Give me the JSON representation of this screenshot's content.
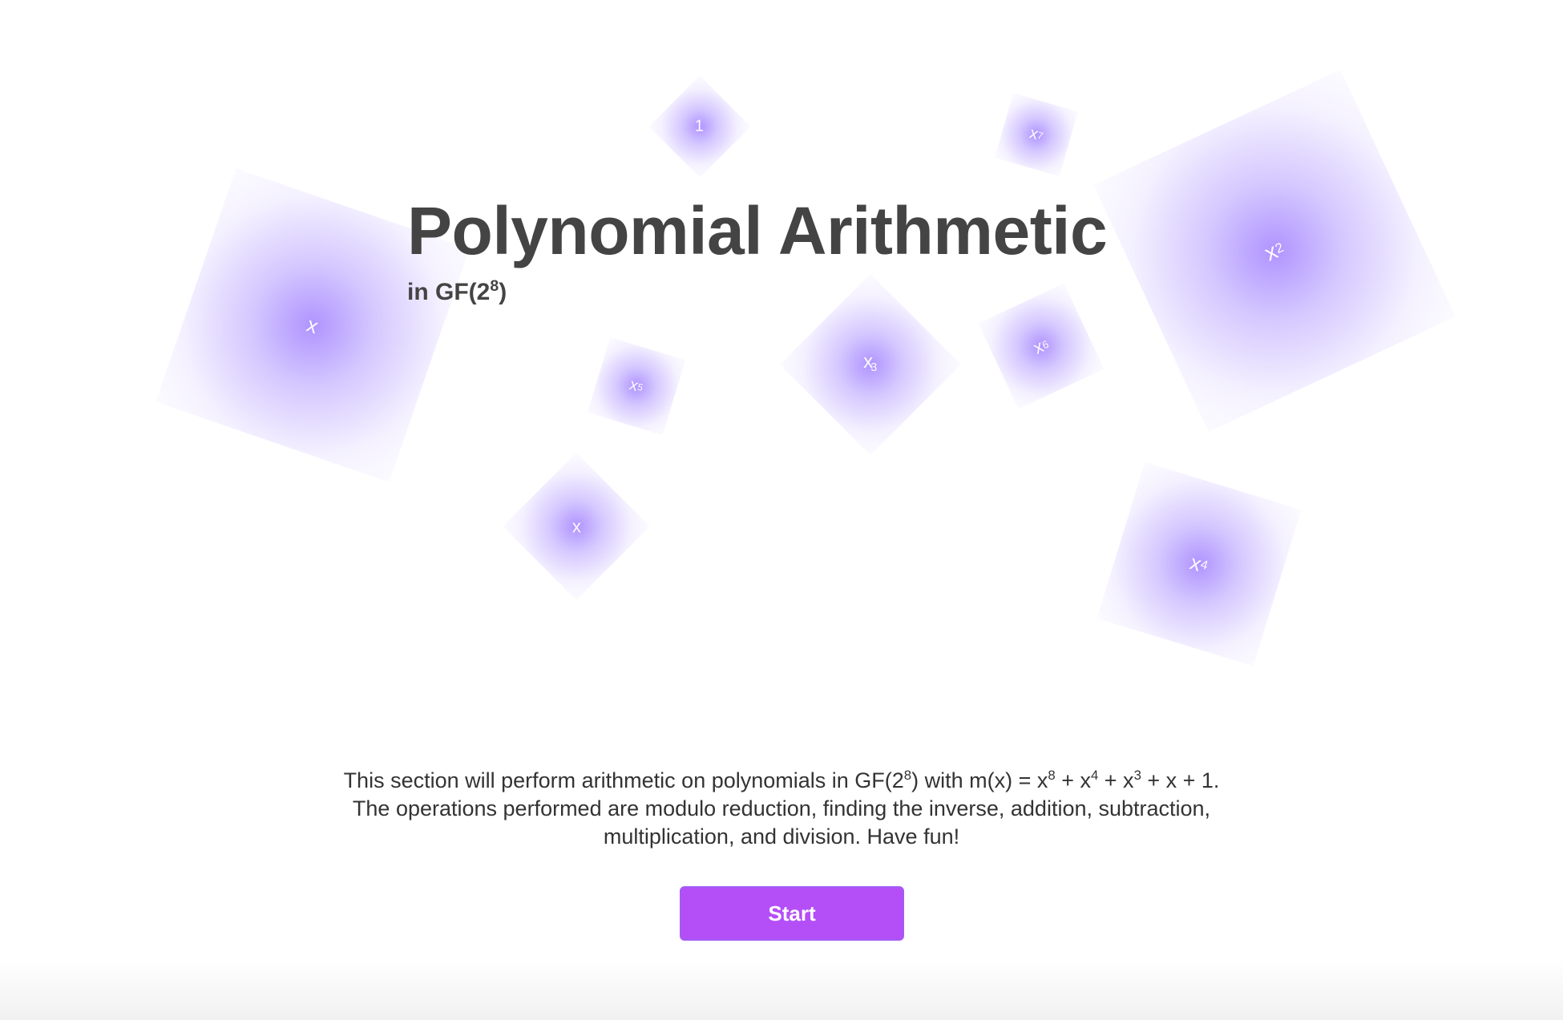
{
  "tiles": [
    {
      "base": "x",
      "exp": ""
    },
    {
      "base": "1",
      "exp": ""
    },
    {
      "base": "x",
      "exp": "7"
    },
    {
      "base": "x",
      "exp": "2"
    },
    {
      "base": "x",
      "exp": "5"
    },
    {
      "base": "x",
      "exp": "3"
    },
    {
      "base": "x",
      "exp": "6"
    },
    {
      "base": "x",
      "exp": ""
    },
    {
      "base": "x",
      "exp": "4"
    }
  ],
  "hero": {
    "title": "Polynomial Arithmetic",
    "subtitle_prefix": "in GF(2",
    "subtitle_exp": "8",
    "subtitle_suffix": ")"
  },
  "description": {
    "p1": "This section will perform arithmetic on polynomials in GF(2",
    "p1_exp": "8",
    "p2": ") with m(x) = x",
    "p2_exp": "8",
    "p3": " + x",
    "p3_exp": "4",
    "p4": " + x",
    "p4_exp": "3",
    "p5": " + x + 1.",
    "line2": "The operations performed are modulo reduction, finding the inverse, addition, subtraction,",
    "line3": "multiplication, and division. Have fun!"
  },
  "actions": {
    "start_label": "Start"
  },
  "colors": {
    "tile_accent": "#ab8eff",
    "title_text": "#444444",
    "button_bg": "#b44ff8"
  }
}
